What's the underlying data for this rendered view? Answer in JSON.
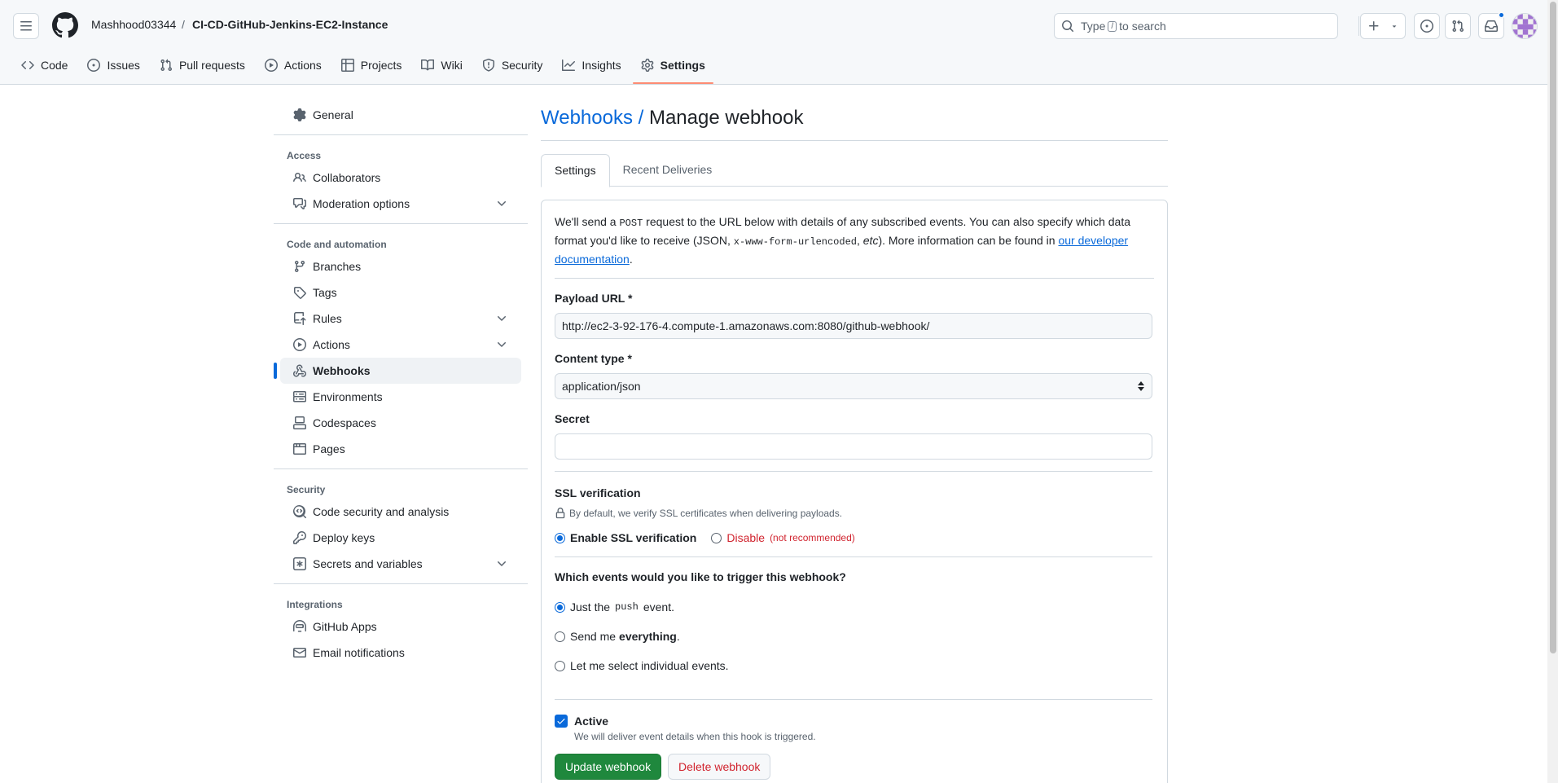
{
  "header": {
    "owner": "Mashhood03344",
    "separator": "/",
    "repo": "CI-CD-GitHub-Jenkins-EC2-Instance",
    "search_prefix": "Type",
    "search_key": "/",
    "search_suffix": "to search"
  },
  "repo_tabs": [
    {
      "label": "Code",
      "icon": "code-icon"
    },
    {
      "label": "Issues",
      "icon": "issue-icon"
    },
    {
      "label": "Pull requests",
      "icon": "pull-request-icon"
    },
    {
      "label": "Actions",
      "icon": "play-icon"
    },
    {
      "label": "Projects",
      "icon": "table-icon"
    },
    {
      "label": "Wiki",
      "icon": "book-icon"
    },
    {
      "label": "Security",
      "icon": "shield-icon"
    },
    {
      "label": "Insights",
      "icon": "graph-icon"
    },
    {
      "label": "Settings",
      "icon": "gear-icon",
      "selected": true
    }
  ],
  "sidebar": {
    "general": "General",
    "access_heading": "Access",
    "collaborators": "Collaborators",
    "moderation": "Moderation options",
    "code_heading": "Code and automation",
    "branches": "Branches",
    "tags": "Tags",
    "rules": "Rules",
    "actions": "Actions",
    "webhooks": "Webhooks",
    "environments": "Environments",
    "codespaces": "Codespaces",
    "pages": "Pages",
    "security_heading": "Security",
    "code_security": "Code security and analysis",
    "deploy_keys": "Deploy keys",
    "secrets": "Secrets and variables",
    "integrations_heading": "Integrations",
    "github_apps": "GitHub Apps",
    "email_notifications": "Email notifications"
  },
  "main": {
    "title_link": "Webhooks /",
    "title": "Manage webhook",
    "tabs": [
      "Settings",
      "Recent Deliveries"
    ],
    "intro_1": "We'll send a",
    "intro_post": "POST",
    "intro_2": "request to the URL below with details of any subscribed events. You can also specify which data format you'd like to receive (JSON,",
    "intro_code": "x-www-form-urlencoded",
    "intro_3": ",",
    "intro_etc": "etc",
    "intro_4": "). More information can be found in",
    "intro_link": "our developer documentation",
    "intro_5": ".",
    "payload_label": "Payload URL *",
    "payload_value": "http://ec2-3-92-176-4.compute-1.amazonaws.com:8080/github-webhook/",
    "content_type_label": "Content type *",
    "content_type_value": "application/json",
    "secret_label": "Secret",
    "secret_value": "",
    "ssl_label": "SSL verification",
    "ssl_note": "By default, we verify SSL certificates when delivering payloads.",
    "ssl_enable": "Enable SSL verification",
    "ssl_disable": "Disable",
    "ssl_not_recommended": "(not recommended)",
    "events_label": "Which events would you like to trigger this webhook?",
    "event_push_1": "Just the",
    "event_push_code": "push",
    "event_push_2": "event.",
    "event_all_1": "Send me",
    "event_all_bold": "everything",
    "event_all_2": ".",
    "event_select": "Let me select individual events.",
    "active_label": "Active",
    "active_note": "We will deliver event details when this hook is triggered.",
    "update_button": "Update webhook",
    "delete_button": "Delete webhook"
  },
  "colors": {
    "accent": "#0969da",
    "danger": "#d1242f",
    "primary_button": "#1f883d",
    "tab_underline": "#fd8c73"
  }
}
